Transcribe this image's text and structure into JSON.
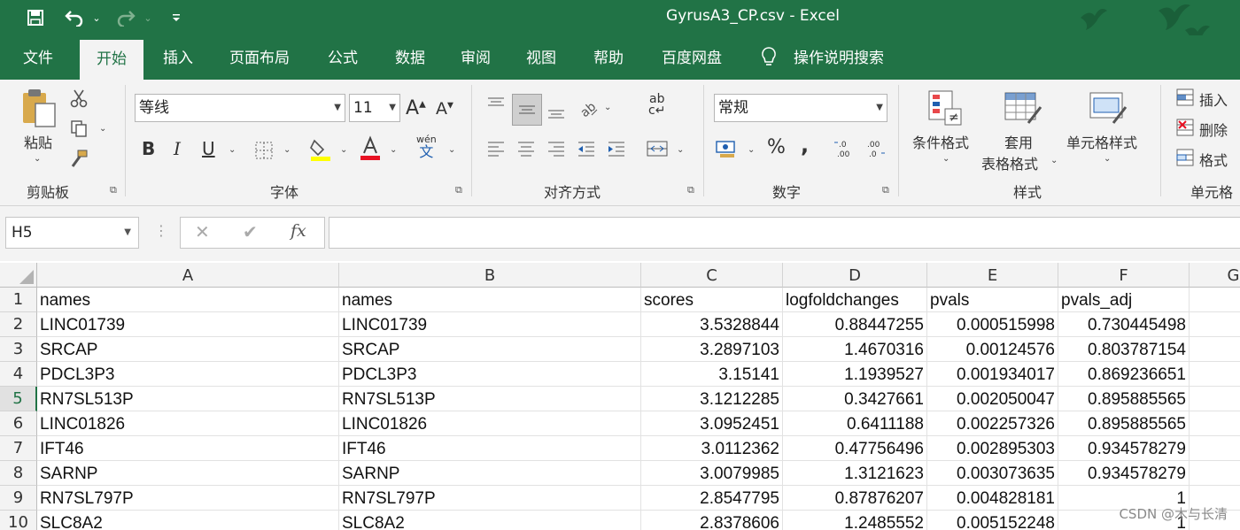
{
  "window": {
    "title": "GyrusA3_CP.csv  -  Excel"
  },
  "quick_access": {
    "save": "save-icon",
    "undo": "undo-icon",
    "redo": "redo-icon",
    "customize": "customize-icon"
  },
  "tabs": [
    {
      "label": "文件",
      "active": false
    },
    {
      "label": "开始",
      "active": true
    },
    {
      "label": "插入",
      "active": false
    },
    {
      "label": "页面布局",
      "active": false
    },
    {
      "label": "公式",
      "active": false
    },
    {
      "label": "数据",
      "active": false
    },
    {
      "label": "审阅",
      "active": false
    },
    {
      "label": "视图",
      "active": false
    },
    {
      "label": "帮助",
      "active": false
    },
    {
      "label": "百度网盘",
      "active": false
    }
  ],
  "tell_me": "操作说明搜索",
  "ribbon": {
    "clipboard": {
      "label": "剪贴板",
      "paste": "粘贴"
    },
    "font": {
      "label": "字体",
      "name": "等线",
      "size": "11",
      "grow": "A",
      "shrink": "A",
      "bold": "B",
      "italic": "I",
      "underline": "U",
      "wen": "wén",
      "wen_char": "文"
    },
    "alignment": {
      "label": "对齐方式",
      "wrap": "ab"
    },
    "number": {
      "label": "数字",
      "format": "常规",
      "percent": "%",
      "comma": ","
    },
    "styles": {
      "label": "样式",
      "conditional": "条件格式",
      "table_1": "套用",
      "table_2": "表格格式",
      "cell_styles": "单元格样式"
    },
    "cells": {
      "label": "单元格",
      "insert": "插入",
      "delete": "删除",
      "format": "格式"
    }
  },
  "formula_bar": {
    "name_box": "H5",
    "fx": "fx",
    "formula": ""
  },
  "grid": {
    "columns": [
      "A",
      "B",
      "C",
      "D",
      "E",
      "F",
      "G"
    ],
    "rows": [
      {
        "n": "1",
        "cells": [
          "names",
          "names",
          "scores",
          "logfoldchanges",
          "pvals",
          "pvals_adj"
        ]
      },
      {
        "n": "2",
        "cells": [
          "LINC01739",
          "LINC01739",
          "3.5328844",
          "0.88447255",
          "0.000515998",
          "0.730445498"
        ]
      },
      {
        "n": "3",
        "cells": [
          "SRCAP",
          "SRCAP",
          "3.2897103",
          "1.4670316",
          "0.00124576",
          "0.803787154"
        ]
      },
      {
        "n": "4",
        "cells": [
          "PDCL3P3",
          "PDCL3P3",
          "3.15141",
          "1.1939527",
          "0.001934017",
          "0.869236651"
        ]
      },
      {
        "n": "5",
        "cells": [
          "RN7SL513P",
          "RN7SL513P",
          "3.1212285",
          "0.3427661",
          "0.002050047",
          "0.895885565"
        ]
      },
      {
        "n": "6",
        "cells": [
          "LINC01826",
          "LINC01826",
          "3.0952451",
          "0.6411188",
          "0.002257326",
          "0.895885565"
        ]
      },
      {
        "n": "7",
        "cells": [
          "IFT46",
          "IFT46",
          "3.0112362",
          "0.47756496",
          "0.002895303",
          "0.934578279"
        ]
      },
      {
        "n": "8",
        "cells": [
          "SARNP",
          "SARNP",
          "3.0079985",
          "1.3121623",
          "0.003073635",
          "0.934578279"
        ]
      },
      {
        "n": "9",
        "cells": [
          "RN7SL797P",
          "RN7SL797P",
          "2.8547795",
          "0.87876207",
          "0.004828181",
          "1"
        ]
      },
      {
        "n": "10",
        "cells": [
          "SLC8A2",
          "SLC8A2",
          "2.8378606",
          "1.2485552",
          "0.005152248",
          "1"
        ]
      }
    ]
  },
  "watermark": "CSDN @木与长清",
  "colors": {
    "accent": "#217346",
    "ribbon_bg": "#f3f3f3"
  }
}
